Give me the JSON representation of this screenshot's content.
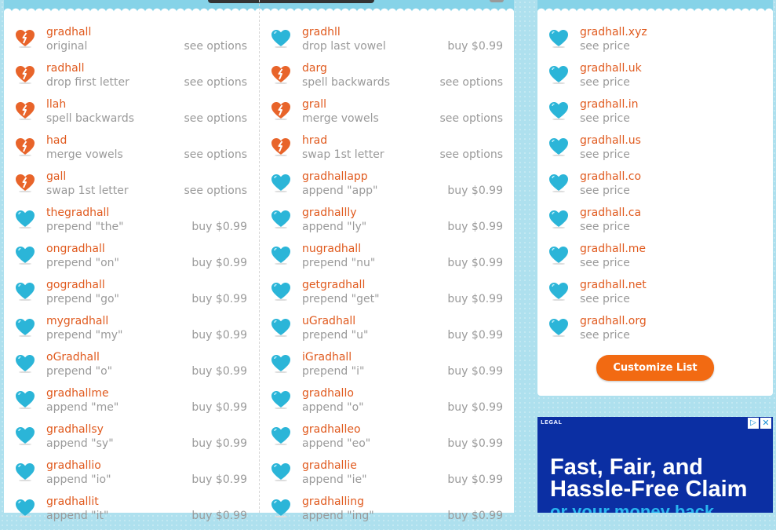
{
  "colors": {
    "accent": "#e05a1e",
    "muted": "#9a9a9a",
    "heart_broken": "#e8642a",
    "heart_ok": "#2bb5d8",
    "button": "#f26a12",
    "ad_bg": "#0b2fa3"
  },
  "main": {
    "left_column": [
      {
        "name": "gradhall",
        "desc": "original",
        "action": "see options",
        "icon": "broken-heart-icon"
      },
      {
        "name": "radhall",
        "desc": "drop first letter",
        "action": "see options",
        "icon": "broken-heart-icon"
      },
      {
        "name": "llah",
        "desc": "spell backwards",
        "action": "see options",
        "icon": "broken-heart-icon"
      },
      {
        "name": "had",
        "desc": "merge vowels",
        "action": "see options",
        "icon": "broken-heart-icon"
      },
      {
        "name": "gall",
        "desc": "swap 1st letter",
        "action": "see options",
        "icon": "broken-heart-icon"
      },
      {
        "name": "thegradhall",
        "desc": "prepend \"the\"",
        "action": "buy $0.99",
        "icon": "heart-icon"
      },
      {
        "name": "ongradhall",
        "desc": "prepend \"on\"",
        "action": "buy $0.99",
        "icon": "heart-icon"
      },
      {
        "name": "gogradhall",
        "desc": "prepend \"go\"",
        "action": "buy $0.99",
        "icon": "heart-icon"
      },
      {
        "name": "mygradhall",
        "desc": "prepend \"my\"",
        "action": "buy $0.99",
        "icon": "heart-icon"
      },
      {
        "name": "oGradhall",
        "desc": "prepend \"o\"",
        "action": "buy $0.99",
        "icon": "heart-icon"
      },
      {
        "name": "gradhallme",
        "desc": "append \"me\"",
        "action": "buy $0.99",
        "icon": "heart-icon"
      },
      {
        "name": "gradhallsy",
        "desc": "append \"sy\"",
        "action": "buy $0.99",
        "icon": "heart-icon"
      },
      {
        "name": "gradhallio",
        "desc": "append \"io\"",
        "action": "buy $0.99",
        "icon": "heart-icon"
      },
      {
        "name": "gradhallit",
        "desc": "append \"it\"",
        "action": "buy $0.99",
        "icon": "heart-icon"
      }
    ],
    "right_column": [
      {
        "name": "gradhll",
        "desc": "drop last vowel",
        "action": "buy $0.99",
        "icon": "heart-icon"
      },
      {
        "name": "darg",
        "desc": "spell backwards",
        "action": "see options",
        "icon": "broken-heart-icon"
      },
      {
        "name": "grall",
        "desc": "merge vowels",
        "action": "see options",
        "icon": "broken-heart-icon"
      },
      {
        "name": "hrad",
        "desc": "swap 1st letter",
        "action": "see options",
        "icon": "broken-heart-icon"
      },
      {
        "name": "gradhallapp",
        "desc": "append \"app\"",
        "action": "buy $0.99",
        "icon": "heart-icon"
      },
      {
        "name": "gradhallly",
        "desc": "append \"ly\"",
        "action": "buy $0.99",
        "icon": "heart-icon"
      },
      {
        "name": "nugradhall",
        "desc": "prepend \"nu\"",
        "action": "buy $0.99",
        "icon": "heart-icon"
      },
      {
        "name": "getgradhall",
        "desc": "prepend \"get\"",
        "action": "buy $0.99",
        "icon": "heart-icon"
      },
      {
        "name": "uGradhall",
        "desc": "prepend \"u\"",
        "action": "buy $0.99",
        "icon": "heart-icon"
      },
      {
        "name": "iGradhall",
        "desc": "prepend \"i\"",
        "action": "buy $0.99",
        "icon": "heart-icon"
      },
      {
        "name": "gradhallo",
        "desc": "append \"o\"",
        "action": "buy $0.99",
        "icon": "heart-icon"
      },
      {
        "name": "gradhalleo",
        "desc": "append \"eo\"",
        "action": "buy $0.99",
        "icon": "heart-icon"
      },
      {
        "name": "gradhallie",
        "desc": "append \"ie\"",
        "action": "buy $0.99",
        "icon": "heart-icon"
      },
      {
        "name": "gradhalling",
        "desc": "append \"ing\"",
        "action": "buy $0.99",
        "icon": "heart-icon"
      }
    ]
  },
  "sidebar": {
    "domains": [
      {
        "name": "gradhall.xyz",
        "desc": "see price",
        "icon": "heart-icon"
      },
      {
        "name": "gradhall.uk",
        "desc": "see price",
        "icon": "heart-icon"
      },
      {
        "name": "gradhall.in",
        "desc": "see price",
        "icon": "heart-icon"
      },
      {
        "name": "gradhall.us",
        "desc": "see price",
        "icon": "heart-icon"
      },
      {
        "name": "gradhall.co",
        "desc": "see price",
        "icon": "heart-icon"
      },
      {
        "name": "gradhall.ca",
        "desc": "see price",
        "icon": "heart-icon"
      },
      {
        "name": "gradhall.me",
        "desc": "see price",
        "icon": "heart-icon"
      },
      {
        "name": "gradhall.net",
        "desc": "see price",
        "icon": "heart-icon"
      },
      {
        "name": "gradhall.org",
        "desc": "see price",
        "icon": "heart-icon"
      }
    ],
    "customize_label": "Customize List"
  },
  "ad": {
    "legal_label": "LEGAL",
    "headline": "Fast, Fair, and Hassle-Free Claim",
    "subline": "or your money back"
  }
}
